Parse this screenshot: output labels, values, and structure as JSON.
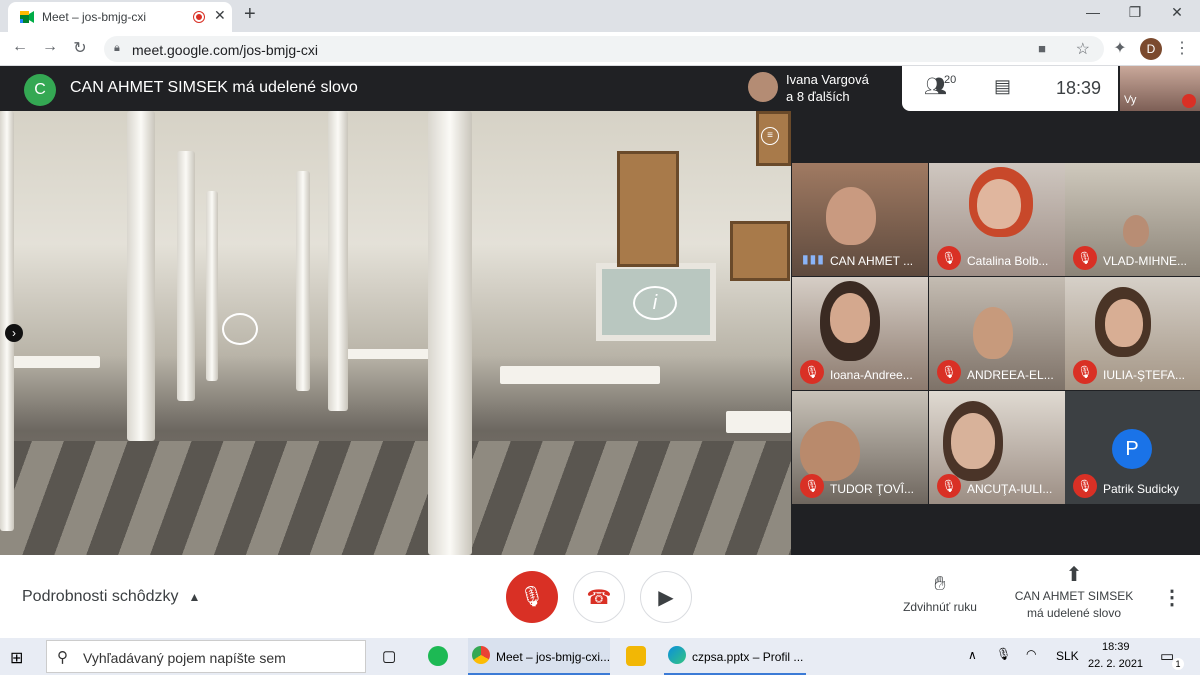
{
  "browser": {
    "tab_title": "Meet – jos-bmjg-cxi",
    "url": "meet.google.com/jos-bmjg-cxi",
    "profile_initial": "D"
  },
  "meet_header": {
    "speaker_initial": "C",
    "speaker_text": "CAN AHMET SIMSEK má udelené slovo",
    "presenter_name": "Ivana Vargová",
    "presenter_others": "a 8 ďalších",
    "participants_count": "20",
    "time": "18:39",
    "self_label": "Vy"
  },
  "participants": [
    {
      "name": "CAN AHMET ...",
      "muted": false,
      "speaking": true
    },
    {
      "name": "Catalina Bolb...",
      "muted": true
    },
    {
      "name": "VLAD-MIHNE...",
      "muted": true
    },
    {
      "name": "Ioana-Andree...",
      "muted": true
    },
    {
      "name": "ANDREEA-EL...",
      "muted": true
    },
    {
      "name": "IULIA-ŞTEFA...",
      "muted": true
    },
    {
      "name": "TUDOR ŢOVÎ...",
      "muted": true
    },
    {
      "name": "ANCUŢA-IULI...",
      "muted": true
    },
    {
      "name": "Patrik Sudicky",
      "muted": true,
      "avatar_initial": "P"
    }
  ],
  "bottom_bar": {
    "details_label": "Podrobnosti schôdzky",
    "raise_hand_label": "Zdvihnúť ruku",
    "presenting_label": "CAN AHMET SIMSEK má udelené slovo"
  },
  "taskbar": {
    "search_placeholder": "Vyhľadávaný pojem napíšte sem",
    "app_meet": "Meet – jos-bmjg-cxi...",
    "app_edge": "czpsa.pptx – Profil ...",
    "lang": "SLK",
    "clock_time": "18:39",
    "clock_date": "22. 2. 2021",
    "notification_count": "1"
  },
  "colors": {
    "meet_dark": "#202124",
    "mute_red": "#d93025",
    "avatar_blue": "#1a73e8",
    "speaker_green": "#34a853"
  }
}
